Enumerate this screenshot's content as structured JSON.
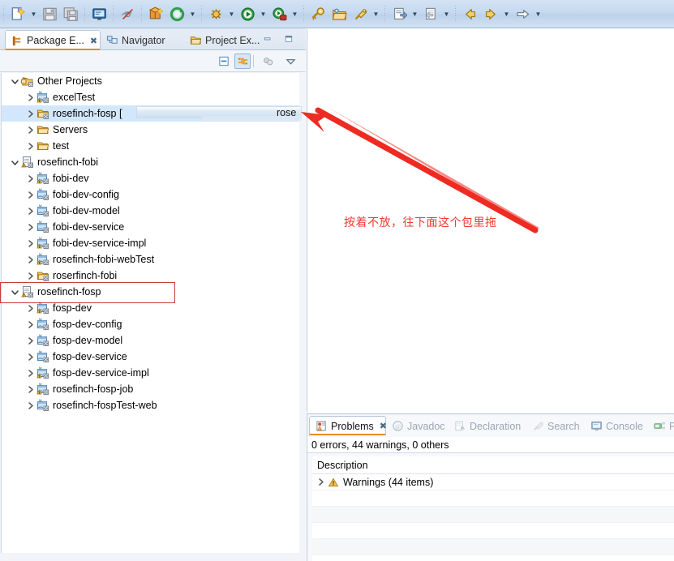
{
  "toolbar": {
    "groups": [
      {
        "items": [
          {
            "name": "new-wizard-button",
            "icon": "new-file-icon",
            "has_arrow": true
          },
          {
            "name": "save-button",
            "icon": "save-icon",
            "has_arrow": false
          },
          {
            "name": "save-all-button",
            "icon": "save-all-icon",
            "has_arrow": false
          }
        ]
      },
      {
        "items": [
          {
            "name": "new-java-console-button",
            "icon": "console-icon",
            "has_arrow": false
          }
        ]
      },
      {
        "items": [
          {
            "name": "skip-breakpoints-button",
            "icon": "skip-breakpoints-icon",
            "has_arrow": false
          }
        ]
      },
      {
        "items": [
          {
            "name": "new-package-button",
            "icon": "new-package-icon",
            "has_arrow": false
          },
          {
            "name": "refresh-button",
            "icon": "refresh-icon",
            "has_arrow": true
          }
        ]
      },
      {
        "items": [
          {
            "name": "debug-button",
            "icon": "debug-icon",
            "has_arrow": true
          },
          {
            "name": "run-button",
            "icon": "run-icon",
            "has_arrow": true
          },
          {
            "name": "run-external-tools-button",
            "icon": "external-tools-icon",
            "has_arrow": true
          }
        ]
      },
      {
        "items": [
          {
            "name": "open-type-button",
            "icon": "open-type-icon",
            "has_arrow": false
          },
          {
            "name": "open-task-button",
            "icon": "open-folder-icon",
            "has_arrow": false
          },
          {
            "name": "search-button",
            "icon": "search-pin-icon",
            "has_arrow": true
          }
        ]
      },
      {
        "items": [
          {
            "name": "next-annotation-button",
            "icon": "next-annotation-icon",
            "has_arrow": true
          },
          {
            "name": "previous-annotation-button",
            "icon": "previous-annotation-icon",
            "has_arrow": true
          }
        ]
      },
      {
        "items": [
          {
            "name": "back-button",
            "icon": "back-arrow-icon",
            "has_arrow": false
          },
          {
            "name": "forward-button",
            "icon": "forward-arrow-icon",
            "has_arrow": true
          },
          {
            "name": "next-edit-button",
            "icon": "right-arrow-icon",
            "has_arrow": true
          }
        ]
      }
    ]
  },
  "left_view": {
    "tabs": [
      {
        "label": "Package E...",
        "icon": "package-explorer-icon",
        "active": true,
        "closable": true
      },
      {
        "label": "Navigator",
        "icon": "navigator-icon",
        "active": false,
        "closable": false
      },
      {
        "label": "Project Ex...",
        "icon": "project-explorer-icon",
        "active": false,
        "closable": false
      }
    ],
    "window_buttons": [
      {
        "name": "minimize-view-button",
        "icon": "minimize-icon"
      },
      {
        "name": "maximize-view-button",
        "icon": "maximize-icon"
      }
    ],
    "view_toolbar": [
      {
        "name": "collapse-all-button",
        "icon": "collapse-all-icon",
        "active": false
      },
      {
        "name": "link-with-editor-button",
        "icon": "link-with-editor-icon",
        "active": true
      },
      {
        "name": "focus-on-active-task-button",
        "icon": "focus-task-icon",
        "active": false
      },
      {
        "name": "view-menu-button",
        "icon": "view-menu-icon",
        "active": false
      }
    ],
    "tree": [
      {
        "label": "Other Projects",
        "indent": 0,
        "twisty": "expanded",
        "icon": "working-set-icon",
        "selected": false
      },
      {
        "label": "excelTest",
        "indent": 1,
        "twisty": "collapsed",
        "icon": "java-project-warn-icon",
        "selected": false
      },
      {
        "label": "rosefinch-fosp [",
        "indent": 1,
        "twisty": "collapsed",
        "icon": "folder-project-icon",
        "selected": true
      },
      {
        "label": "Servers",
        "indent": 1,
        "twisty": "collapsed",
        "icon": "folder-icon",
        "selected": false
      },
      {
        "label": "test",
        "indent": 1,
        "twisty": "collapsed",
        "icon": "folder-icon",
        "selected": false
      },
      {
        "label": "rosefinch-fobi",
        "indent": 0,
        "twisty": "expanded",
        "icon": "maven-project-warn-icon",
        "selected": false
      },
      {
        "label": "fobi-dev",
        "indent": 1,
        "twisty": "collapsed",
        "icon": "java-project-warn-icon",
        "selected": false
      },
      {
        "label": "fobi-dev-config",
        "indent": 1,
        "twisty": "collapsed",
        "icon": "java-project-icon",
        "selected": false
      },
      {
        "label": "fobi-dev-model",
        "indent": 1,
        "twisty": "collapsed",
        "icon": "java-project-icon",
        "selected": false
      },
      {
        "label": "fobi-dev-service",
        "indent": 1,
        "twisty": "collapsed",
        "icon": "java-project-icon",
        "selected": false
      },
      {
        "label": "fobi-dev-service-impl",
        "indent": 1,
        "twisty": "collapsed",
        "icon": "java-project-warn-icon",
        "selected": false
      },
      {
        "label": "rosefinch-fobi-webTest",
        "indent": 1,
        "twisty": "collapsed",
        "icon": "java-project-warn-icon",
        "selected": false
      },
      {
        "label": "roserfinch-fobi",
        "indent": 1,
        "twisty": "collapsed",
        "icon": "folder-project-icon",
        "selected": false
      },
      {
        "label": "rosefinch-fosp",
        "indent": 0,
        "twisty": "expanded",
        "icon": "maven-project-warn-icon",
        "selected": false
      },
      {
        "label": "fosp-dev",
        "indent": 1,
        "twisty": "collapsed",
        "icon": "java-project-warn-icon",
        "selected": false
      },
      {
        "label": "fosp-dev-config",
        "indent": 1,
        "twisty": "collapsed",
        "icon": "java-project-icon",
        "selected": false
      },
      {
        "label": "fosp-dev-model",
        "indent": 1,
        "twisty": "collapsed",
        "icon": "java-project-icon",
        "selected": false
      },
      {
        "label": "fosp-dev-service",
        "indent": 1,
        "twisty": "collapsed",
        "icon": "java-project-icon",
        "selected": false
      },
      {
        "label": "fosp-dev-service-impl",
        "indent": 1,
        "twisty": "collapsed",
        "icon": "java-project-warn-icon",
        "selected": false
      },
      {
        "label": "rosefinch-fosp-job",
        "indent": 1,
        "twisty": "collapsed",
        "icon": "java-project-warn-icon",
        "selected": false
      },
      {
        "label": "rosefinch-fospTest-web",
        "indent": 1,
        "twisty": "collapsed",
        "icon": "java-project-icon",
        "selected": false
      }
    ]
  },
  "drag": {
    "ghost_text": "rose"
  },
  "annotation": {
    "text": "按着不放，往下面这个包里拖",
    "color": "#ee3b33",
    "arrow_color": "#ee2b22"
  },
  "highlight": {
    "box_color": "#c83c3c",
    "target_label": "rosefinch-fosp"
  },
  "bottom_panel": {
    "tabs": [
      {
        "label": "Problems",
        "icon": "problems-icon",
        "active": true,
        "closable": true
      },
      {
        "label": "Javadoc",
        "icon": "javadoc-icon",
        "active": false,
        "closable": false
      },
      {
        "label": "Declaration",
        "icon": "declaration-icon",
        "active": false,
        "closable": false
      },
      {
        "label": "Search",
        "icon": "search-icon",
        "active": false,
        "closable": false
      },
      {
        "label": "Console",
        "icon": "console-tab-icon",
        "active": false,
        "closable": false
      },
      {
        "label": "P",
        "icon": "progress-icon",
        "active": false,
        "closable": false
      }
    ],
    "status": "0 errors, 44 warnings, 0 others",
    "column_header": "Description",
    "rows": [
      {
        "label": "Warnings (44 items)",
        "twisty": "collapsed",
        "icon": "warning-icon"
      }
    ]
  }
}
